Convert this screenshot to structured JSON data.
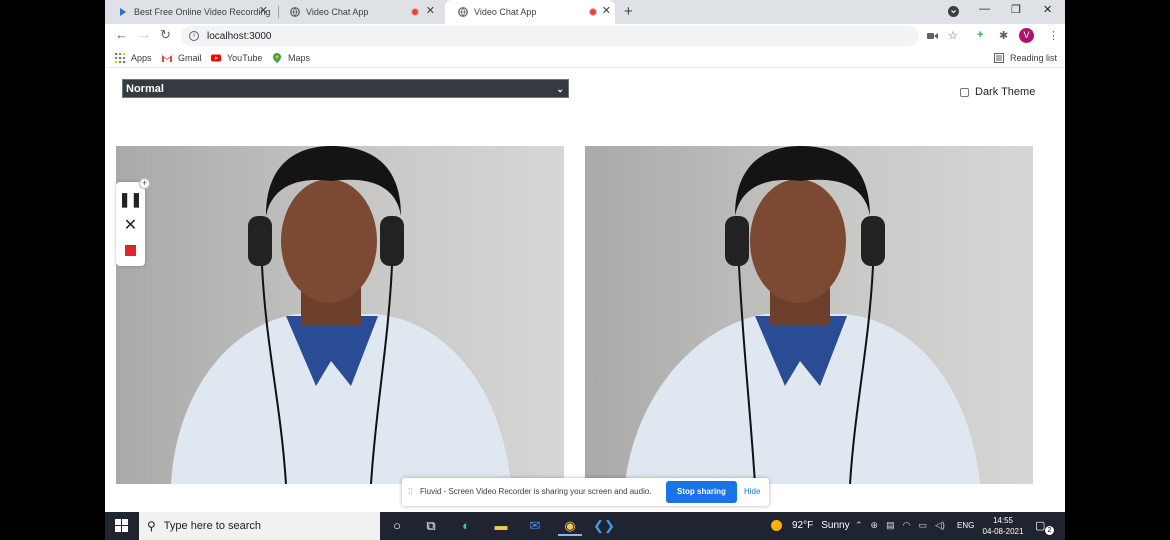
{
  "browser": {
    "tabs": [
      {
        "title": "Best Free Online Video Recording",
        "active": false,
        "recording": false
      },
      {
        "title": "Video Chat App",
        "active": false,
        "recording": true
      },
      {
        "title": "Video Chat App",
        "active": true,
        "recording": true
      }
    ],
    "new_tab": "+",
    "window": {
      "minimize": "—",
      "restore": "❐",
      "close": "✕"
    },
    "address": "localhost:3000",
    "bookmarks": [
      "Apps",
      "Gmail",
      "YouTube",
      "Maps"
    ],
    "reading_list": "Reading list",
    "profile_initial": "V"
  },
  "page": {
    "filter_value": "Normal",
    "dark_theme_label": "Dark Theme"
  },
  "share_bar": {
    "message": "Fluvid - Screen Video Recorder is sharing your screen and audio.",
    "stop_label": "Stop sharing",
    "hide_label": "Hide"
  },
  "taskbar": {
    "search_placeholder": "Type here to search",
    "temperature": "92°F",
    "weather": "Sunny",
    "language": "ENG",
    "time": "14:55",
    "date": "04-08-2021",
    "notifications": "2"
  },
  "colors": {
    "accent": "#1a73e8",
    "recording": "#ea4335",
    "select_bg": "#343a40",
    "taskbar": "#1f2430"
  }
}
